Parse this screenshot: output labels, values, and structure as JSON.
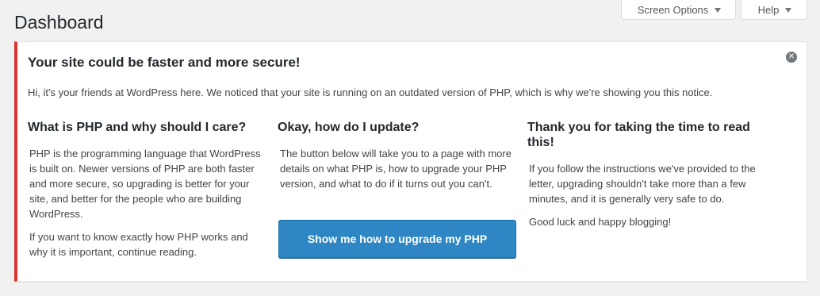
{
  "header": {
    "title": "Dashboard",
    "screen_options_label": "Screen Options",
    "help_label": "Help"
  },
  "notice": {
    "title": "Your site could be faster and more secure!",
    "intro": "Hi, it's your friends at WordPress here. We noticed that your site is running on an outdated version of PHP, which is why we're showing you this notice.",
    "dismiss_icon": "dismiss-icon",
    "accent_color": "#dc3232",
    "columns": [
      {
        "heading": "What is PHP and why should I care?",
        "paragraphs": [
          "PHP is the programming language that WordPress is built on. Newer versions of PHP are both faster and more secure, so upgrading is better for your site, and better for the people who are building WordPress.",
          "If you want to know exactly how PHP works and why it is important, continue reading."
        ]
      },
      {
        "heading": "Okay, how do I update?",
        "paragraphs": [
          "The button below will take you to a page with more details on what PHP is, how to upgrade your PHP version, and what to do if it turns out you can't."
        ],
        "button_label": "Show me how to upgrade my PHP",
        "button_color": "#2e87c4"
      },
      {
        "heading": "Thank you for taking the time to read this!",
        "paragraphs": [
          "If you follow the instructions we've provided to the letter, upgrading shouldn't take more than a few minutes, and it is generally very safe to do.",
          "Good luck and happy blogging!"
        ]
      }
    ]
  }
}
